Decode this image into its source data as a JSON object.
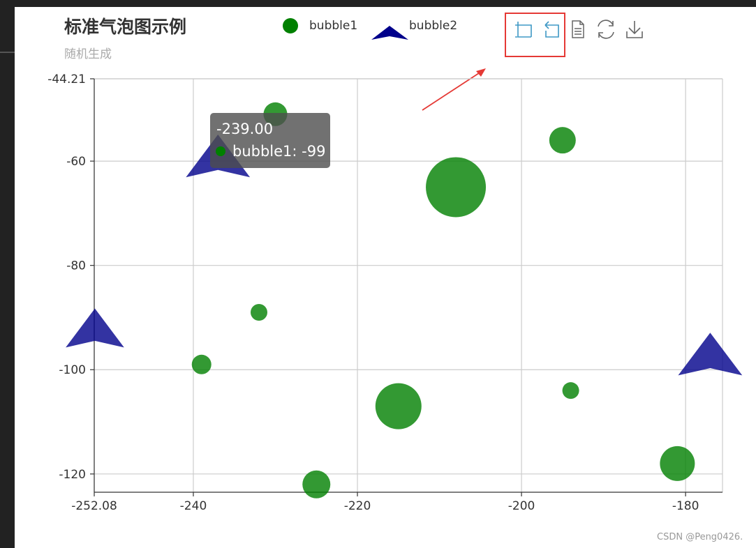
{
  "chart_data": {
    "type": "scatter",
    "title": "标准气泡图示例",
    "subtitle": "随机生成",
    "xlim": [
      -252.08,
      -175.5
    ],
    "ylim": [
      -123.5,
      -44.21
    ],
    "x_ticks": [
      {
        "value": -252.08,
        "label": "-252.08"
      },
      {
        "value": -240,
        "label": "-240"
      },
      {
        "value": -220,
        "label": "-220"
      },
      {
        "value": -200,
        "label": "-200"
      },
      {
        "value": -180,
        "label": "-180"
      }
    ],
    "y_ticks": [
      {
        "value": -44.21,
        "label": "-44.21"
      },
      {
        "value": -60,
        "label": "-60"
      },
      {
        "value": -80,
        "label": "-80"
      },
      {
        "value": -100,
        "label": "-100"
      },
      {
        "value": -120,
        "label": "-120"
      }
    ],
    "grid": true,
    "legend_position": "top-center",
    "series": [
      {
        "name": "bubble1",
        "symbol": "circle",
        "color": "#008000",
        "points": [
          {
            "x": -230,
            "y": -51,
            "size": 17
          },
          {
            "x": -195,
            "y": -56,
            "size": 19
          },
          {
            "x": -208,
            "y": -65,
            "size": 43
          },
          {
            "x": -232,
            "y": -89,
            "size": 12
          },
          {
            "x": -239,
            "y": -99,
            "size": 14
          },
          {
            "x": -215,
            "y": -107,
            "size": 33
          },
          {
            "x": -194,
            "y": -104,
            "size": 12
          },
          {
            "x": -181,
            "y": -118,
            "size": 25
          },
          {
            "x": -225,
            "y": -122,
            "size": 20
          }
        ]
      },
      {
        "name": "bubble2",
        "symbol": "arrow",
        "color": "#00008b",
        "points": [
          {
            "x": -237,
            "y": -59,
            "size": 34
          },
          {
            "x": -252,
            "y": -92,
            "size": 31
          },
          {
            "x": -177,
            "y": -97,
            "size": 34
          }
        ]
      }
    ],
    "tooltip": {
      "line1": "-239.00",
      "line2": "bubble1: -99"
    }
  },
  "toolbox": {
    "items": [
      "zoom-icon",
      "zoom-reset-icon",
      "data-view-icon",
      "restore-icon",
      "save-image-icon"
    ],
    "highlight_color": "#e53935",
    "icon_active_color": "#3e98c5",
    "icon_color": "#666666"
  },
  "watermark": "CSDN @Peng0426."
}
